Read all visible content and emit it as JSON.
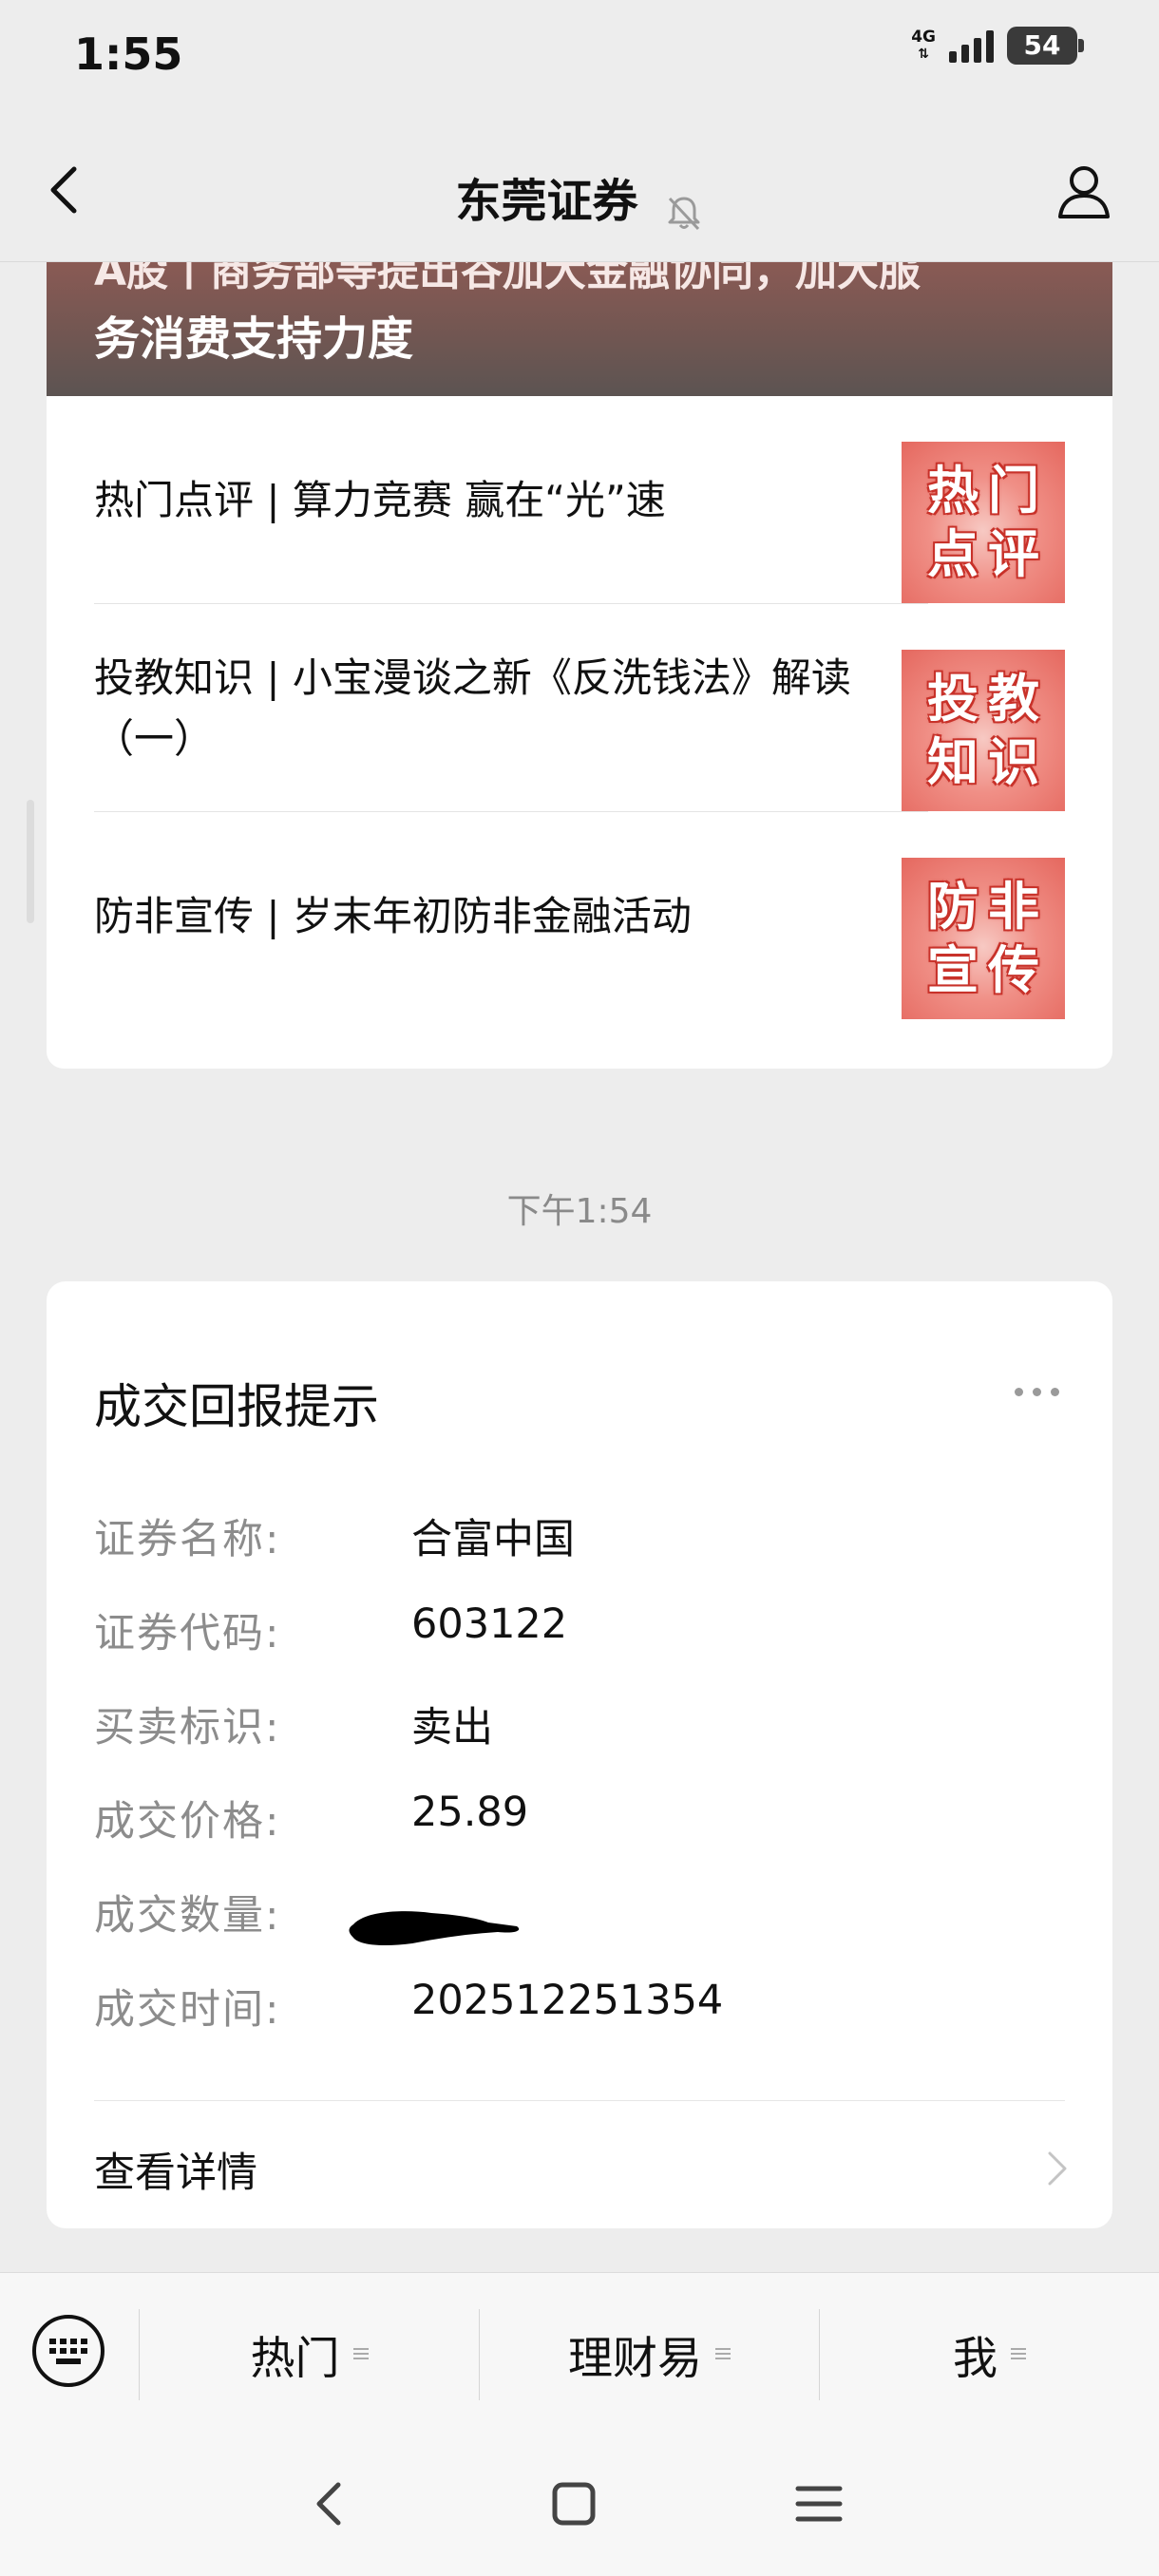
{
  "status_bar": {
    "time": "1:55",
    "network": "4G",
    "battery": "54"
  },
  "header": {
    "title": "东莞证券"
  },
  "articles": {
    "banner_title": "务消费支持力度",
    "banner_clipped": "A股丨商务部等提出谷加大金融协同，加大服",
    "items": [
      {
        "title": "热门点评 | 算力竞赛 赢在“光”速",
        "thumb": [
          "热",
          "门",
          "点",
          "评"
        ]
      },
      {
        "title": "投教知识 | 小宝漫谈之新《反洗钱法》解读（一）",
        "thumb": [
          "投",
          "教",
          "知",
          "识"
        ]
      },
      {
        "title": "防非宣传 | 岁末年初防非金融活动",
        "thumb": [
          "防",
          "非",
          "宣",
          "传"
        ]
      }
    ]
  },
  "timestamp": "下午1:54",
  "trade_notice": {
    "title": "成交回报提示",
    "fields": [
      {
        "label": "证券名称:",
        "value": "合富中国"
      },
      {
        "label": "证券代码:",
        "value": "603122"
      },
      {
        "label": "买卖标识:",
        "value": "卖出"
      },
      {
        "label": "成交价格:",
        "value": "25.89"
      },
      {
        "label": "成交数量:",
        "value": ""
      },
      {
        "label": "成交时间:",
        "value": "202512251354"
      }
    ],
    "detail_link": "查看详情"
  },
  "bottom_menu": {
    "items": [
      "热门",
      "理财易",
      "我"
    ]
  },
  "colors": {
    "banner": "#6f5652",
    "thumb_red": "#e5685f",
    "page_bg": "#ededed"
  }
}
